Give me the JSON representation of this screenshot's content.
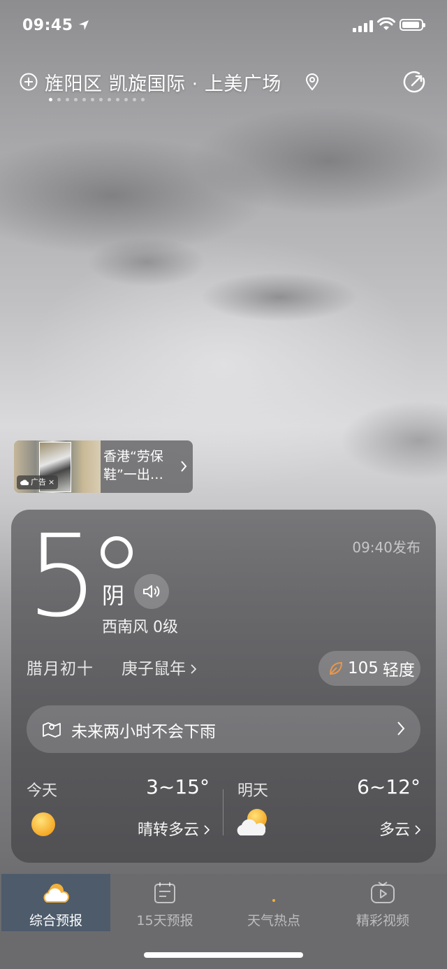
{
  "status_bar": {
    "time": "09:45"
  },
  "header": {
    "location": "旌阳区 凯旋国际 · 上美广场"
  },
  "ad": {
    "text": "香港“劳保鞋”一出…",
    "tag": "广告",
    "close": "×"
  },
  "weather": {
    "temperature": "5",
    "condition": "阴",
    "wind": "西南风 0级",
    "published": "09:40发布",
    "lunar_date": "腊月初十",
    "zodiac_year": "庚子鼠年",
    "aqi_value": "105",
    "aqi_level": "轻度",
    "aqi_color": "#e8964a",
    "rain_forecast": "未来两小时不会下雨"
  },
  "forecast": {
    "today": {
      "label": "今天",
      "range": "3~15°",
      "desc": "晴转多云",
      "icon": "sun-icon"
    },
    "tomorrow": {
      "label": "明天",
      "range": "6~12°",
      "desc": "多云",
      "icon": "partly-cloudy-icon"
    }
  },
  "tabs": [
    {
      "label": "综合预报",
      "icon": "weather-overview-icon",
      "active": true
    },
    {
      "label": "15天预报",
      "icon": "calendar-icon",
      "active": false
    },
    {
      "label": "天气热点",
      "icon": "hotspot-icon",
      "active": false
    },
    {
      "label": "精彩视频",
      "icon": "video-icon",
      "active": false
    }
  ]
}
